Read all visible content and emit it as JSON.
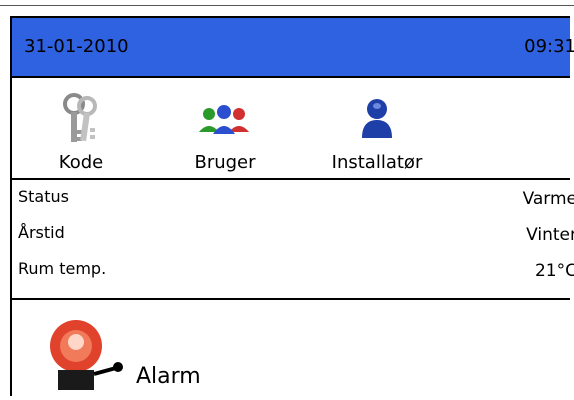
{
  "header": {
    "date": "31-01-2010",
    "time": "09:31",
    "background_color": "#2f62e0"
  },
  "users": [
    {
      "label": "Kode",
      "icon": "keys-icon"
    },
    {
      "label": "Bruger",
      "icon": "users-group-icon"
    },
    {
      "label": "Installatør",
      "icon": "installer-user-icon"
    }
  ],
  "status": {
    "rows": [
      {
        "label": "Status",
        "value": "Varme"
      },
      {
        "label": "Årstid",
        "value": "Vinter"
      },
      {
        "label": "Rum temp.",
        "value": "21°C"
      }
    ]
  },
  "alarm": {
    "label": "Alarm",
    "icon": "alarm-bell-icon",
    "icon_color": "#e0422c"
  }
}
